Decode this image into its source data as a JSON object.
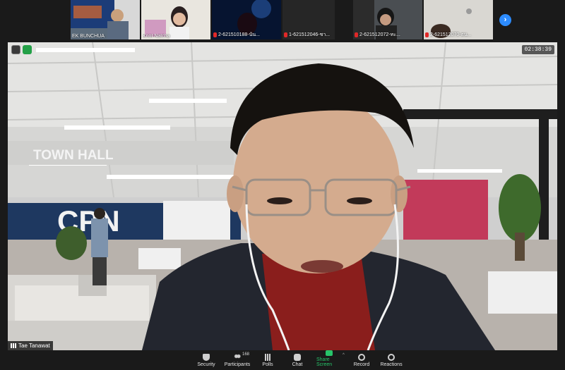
{
  "thumbnails": [
    {
      "name": "EK BUNCHUA",
      "muted": false
    },
    {
      "name": "Knot Natcha",
      "muted": false
    },
    {
      "name": "2-621510188-นัน...",
      "muted": true
    },
    {
      "name": "1-621512046-ชา...",
      "muted": true
    },
    {
      "name": "2-621512072-ทะ...",
      "muted": true
    },
    {
      "name": "2-621512070-ธน...",
      "muted": true
    }
  ],
  "next_page_icon": "chevron-right-icon",
  "main_video": {
    "timer": "02:38:39",
    "speaker_name": "Tae Tanawat",
    "background_text": {
      "town_hall": "TOWN HALL",
      "cpn": "CPN"
    }
  },
  "toolbar": {
    "security": "Security",
    "participants": "Participants",
    "participant_count": "168",
    "polls": "Polls",
    "chat": "Chat",
    "share_screen": "Share Screen",
    "record": "Record",
    "reactions": "Reactions"
  },
  "colors": {
    "accent": "#2d8cff",
    "share_green": "#27c46a",
    "muted_red": "#e02828",
    "toolbar_bg": "#1a1a1a"
  }
}
